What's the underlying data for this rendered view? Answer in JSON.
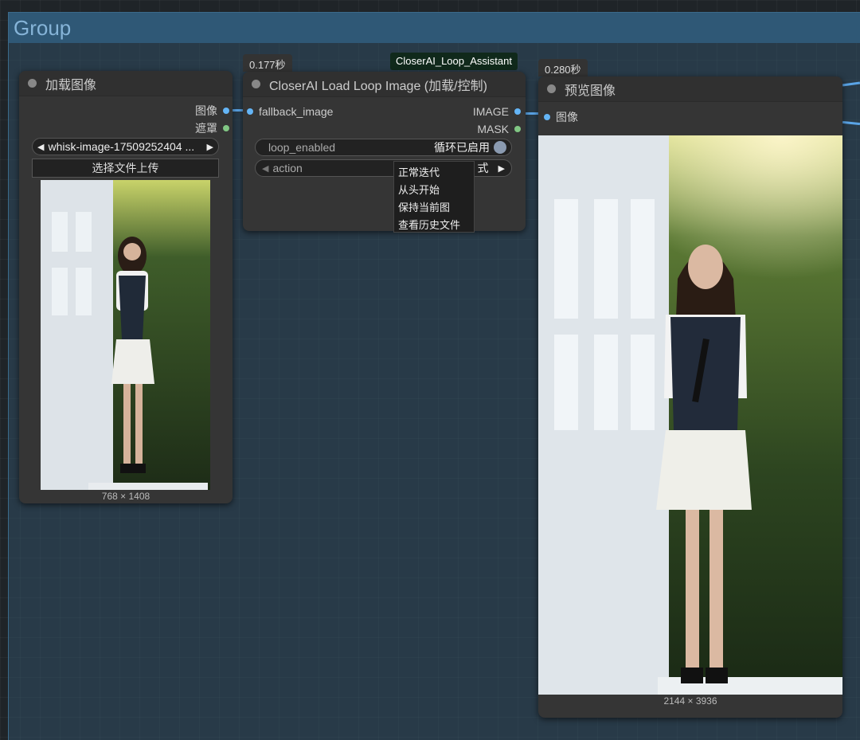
{
  "group": {
    "title": "Group"
  },
  "load_node": {
    "title": "加载图像",
    "outputs": {
      "image": "图像",
      "mask": "遮罩"
    },
    "file_selector": {
      "value": "whisk-image-17509252404 ..."
    },
    "upload_button": "选择文件上传",
    "image_size": "768 × 1408"
  },
  "loop_node": {
    "timing": "0.177秒",
    "badge": "CloserAI_Loop_Assistant",
    "title": "CloserAI Load Loop Image (加载/控制)",
    "input": "fallback_image",
    "outputs": {
      "image": "IMAGE",
      "mask": "MASK"
    },
    "loop_enabled": {
      "label": "loop_enabled",
      "value": "循环已启用"
    },
    "action": {
      "label": "action",
      "value_fragment": "式"
    },
    "menu": [
      "正常迭代",
      "从头开始",
      "保持当前图",
      "查看历史文件"
    ]
  },
  "preview_node": {
    "timing": "0.280秒",
    "title": "预览图像",
    "input": "图像",
    "image_size": "2144 × 3936"
  },
  "icons": {
    "left_arrow": "triangle-left-icon",
    "right_arrow": "triangle-right-icon"
  }
}
